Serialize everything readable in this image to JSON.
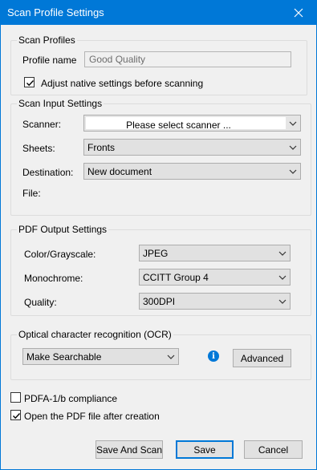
{
  "window": {
    "title": "Scan Profile Settings"
  },
  "scan_profiles": {
    "legend": "Scan Profiles",
    "profile_name_label": "Profile name",
    "profile_name_value": "Good Quality",
    "adjust_native_label": "Adjust native settings before scanning",
    "adjust_native_checked": true
  },
  "scan_input": {
    "legend": "Scan Input Settings",
    "scanner_label": "Scanner:",
    "scanner_value": "Please select scanner ...",
    "sheets_label": "Sheets:",
    "sheets_value": "Fronts",
    "destination_label": "Destination:",
    "destination_value": "New document",
    "file_label": "File:"
  },
  "pdf_output": {
    "legend": "PDF Output Settings",
    "color_label": "Color/Grayscale:",
    "color_value": "JPEG",
    "mono_label": "Monochrome:",
    "mono_value": "CCITT Group 4",
    "quality_label": "Quality:",
    "quality_value": "300DPI"
  },
  "ocr": {
    "legend": "Optical character recognition (OCR)",
    "mode_value": "Make Searchable",
    "advanced_label": "Advanced"
  },
  "options": {
    "pdfa_label": "PDFA-1/b compliance",
    "pdfa_checked": false,
    "open_after_label": "Open the PDF file after creation",
    "open_after_checked": true
  },
  "buttons": {
    "save_and_scan": "Save And Scan",
    "save": "Save",
    "cancel": "Cancel"
  },
  "icons": {
    "close": "close-icon",
    "info": "info-icon",
    "dropdown": "chevron-down-icon",
    "check": "check-icon"
  },
  "colors": {
    "title_bar": "#0078d7",
    "accent": "#0078d7"
  }
}
